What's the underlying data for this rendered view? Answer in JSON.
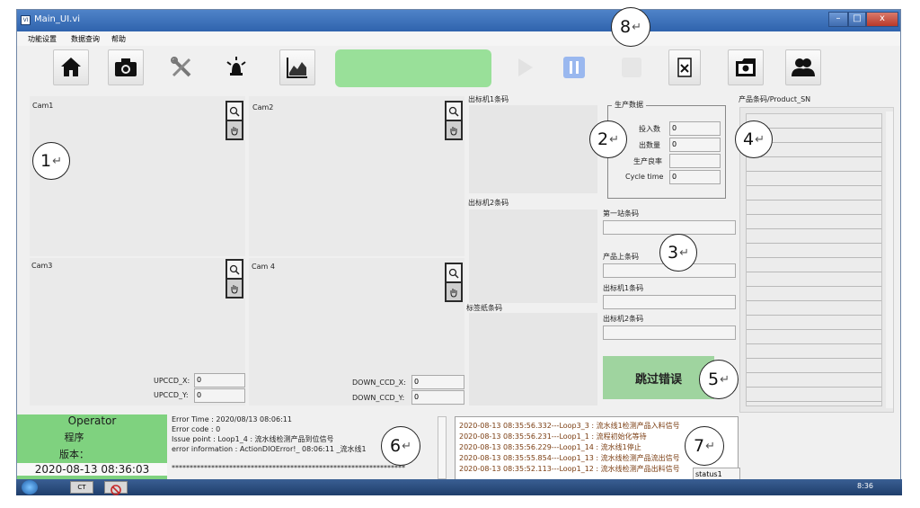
{
  "window": {
    "title": "Main_UI.vi",
    "icon": "VI",
    "minimize": "–",
    "maximize": "□",
    "close": "x"
  },
  "menu": [
    "功能设置",
    "数据查询",
    "帮助"
  ],
  "toolbar": {
    "icons": [
      "home-icon",
      "camera-icon",
      "tools-icon",
      "alarm-icon",
      "chart-icon",
      "play-icon",
      "pause-icon",
      "stop-icon",
      "excel-icon",
      "snapshot-icon",
      "users-icon"
    ],
    "status_color": "#99e099"
  },
  "cams": {
    "cam1": "Cam1",
    "cam2": "Cam2",
    "cam3": "Cam3",
    "cam4": "Cam 4"
  },
  "ccd": {
    "up_x_label": "UPCCD_X:",
    "up_x": "0",
    "up_y_label": "UPCCD_Y:",
    "up_y": "0",
    "down_x_label": "DOWN_CCD_X:",
    "down_x": "0",
    "down_y_label": "DOWN_CCD_Y:",
    "down_y": "0"
  },
  "barcodes": {
    "m1": "出标机1条码",
    "m2": "出标机2条码",
    "label": "标签纸条码"
  },
  "production": {
    "title": "生产数据",
    "input_label": "投入数",
    "input_value": "0",
    "output_label": "出数量",
    "output_value": "0",
    "yield_label": "生产良率",
    "yield_value": "",
    "cycle_label": "Cycle time",
    "cycle_value": "0"
  },
  "stations": {
    "first": "第一站条码",
    "product": "产品上条码",
    "out1": "出标机1条码",
    "out2": "出标机2条码"
  },
  "skip_button": "跳过错误",
  "sn_panel": {
    "title": "产品条码/Product_SN"
  },
  "operator": {
    "role": "Operator",
    "program": "程序",
    "version": "版本：",
    "datetime": "2020-08-13  08:36:03"
  },
  "error": {
    "time": "Error Time :     2020/08/13  08:06:11",
    "code": "Error code : 0",
    "issue": "Issue point : Loop1_4 : 流水线检测产品到位信号",
    "info": "error information : ActionDIOError!_ 08:06:11   _流水线1",
    "stars": "*****************************************************************"
  },
  "log": [
    "2020-08-13 08:35:56.332---Loop3_3 : 流水线1检测产品入料信号",
    "2020-08-13 08:35:56.231---Loop1_1 : 流程初始化等待",
    "2020-08-13 08:35:56.229---Loop1_14 : 流水线1停止",
    "2020-08-13 08:35:55.854---Loop1_13 : 流水线检测产品流出信号",
    "2020-08-13 08:35:52.113---Loop1_12 : 流水线检测产品出料信号"
  ],
  "status_label": "status1",
  "taskbar": {
    "clock": "8:36",
    "task": "CT"
  },
  "markers": [
    "1",
    "2",
    "3",
    "4",
    "5",
    "6",
    "7",
    "8"
  ],
  "return_glyph": "↵"
}
